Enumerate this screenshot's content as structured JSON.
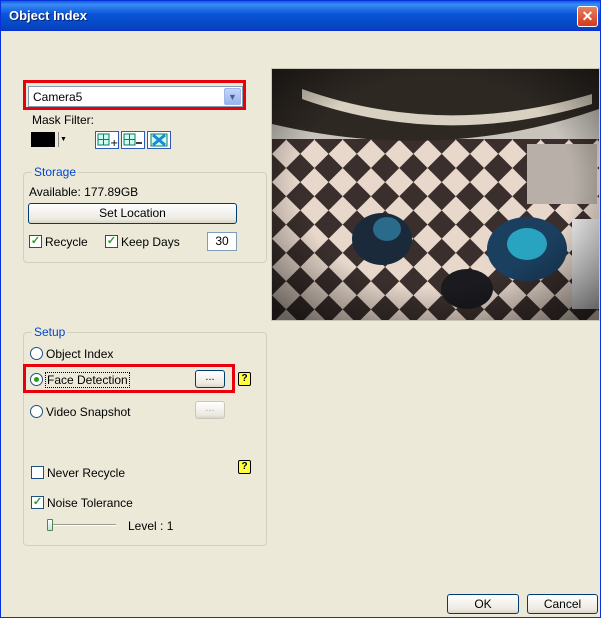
{
  "window": {
    "title": "Object Index",
    "close": "✕"
  },
  "camera": {
    "selected": "Camera5"
  },
  "mask_filter": {
    "label": "Mask Filter:"
  },
  "storage": {
    "title": "Storage",
    "available": "Available: 177.89GB",
    "set_location": "Set Location",
    "recycle_label": "Recycle",
    "recycle_checked": true,
    "keep_days_label": "Keep Days",
    "keep_days_checked": true,
    "keep_days_value": "30"
  },
  "setup": {
    "title": "Setup",
    "object_index": "Object Index",
    "face_detection": "Face Detection",
    "video_snapshot": "Video Snapshot",
    "browse": "...",
    "never_recycle": "Never Recycle",
    "noise_tolerance": "Noise Tolerance",
    "level": "Level : 1",
    "help": "?"
  },
  "buttons": {
    "ok": "OK",
    "cancel": "Cancel"
  }
}
